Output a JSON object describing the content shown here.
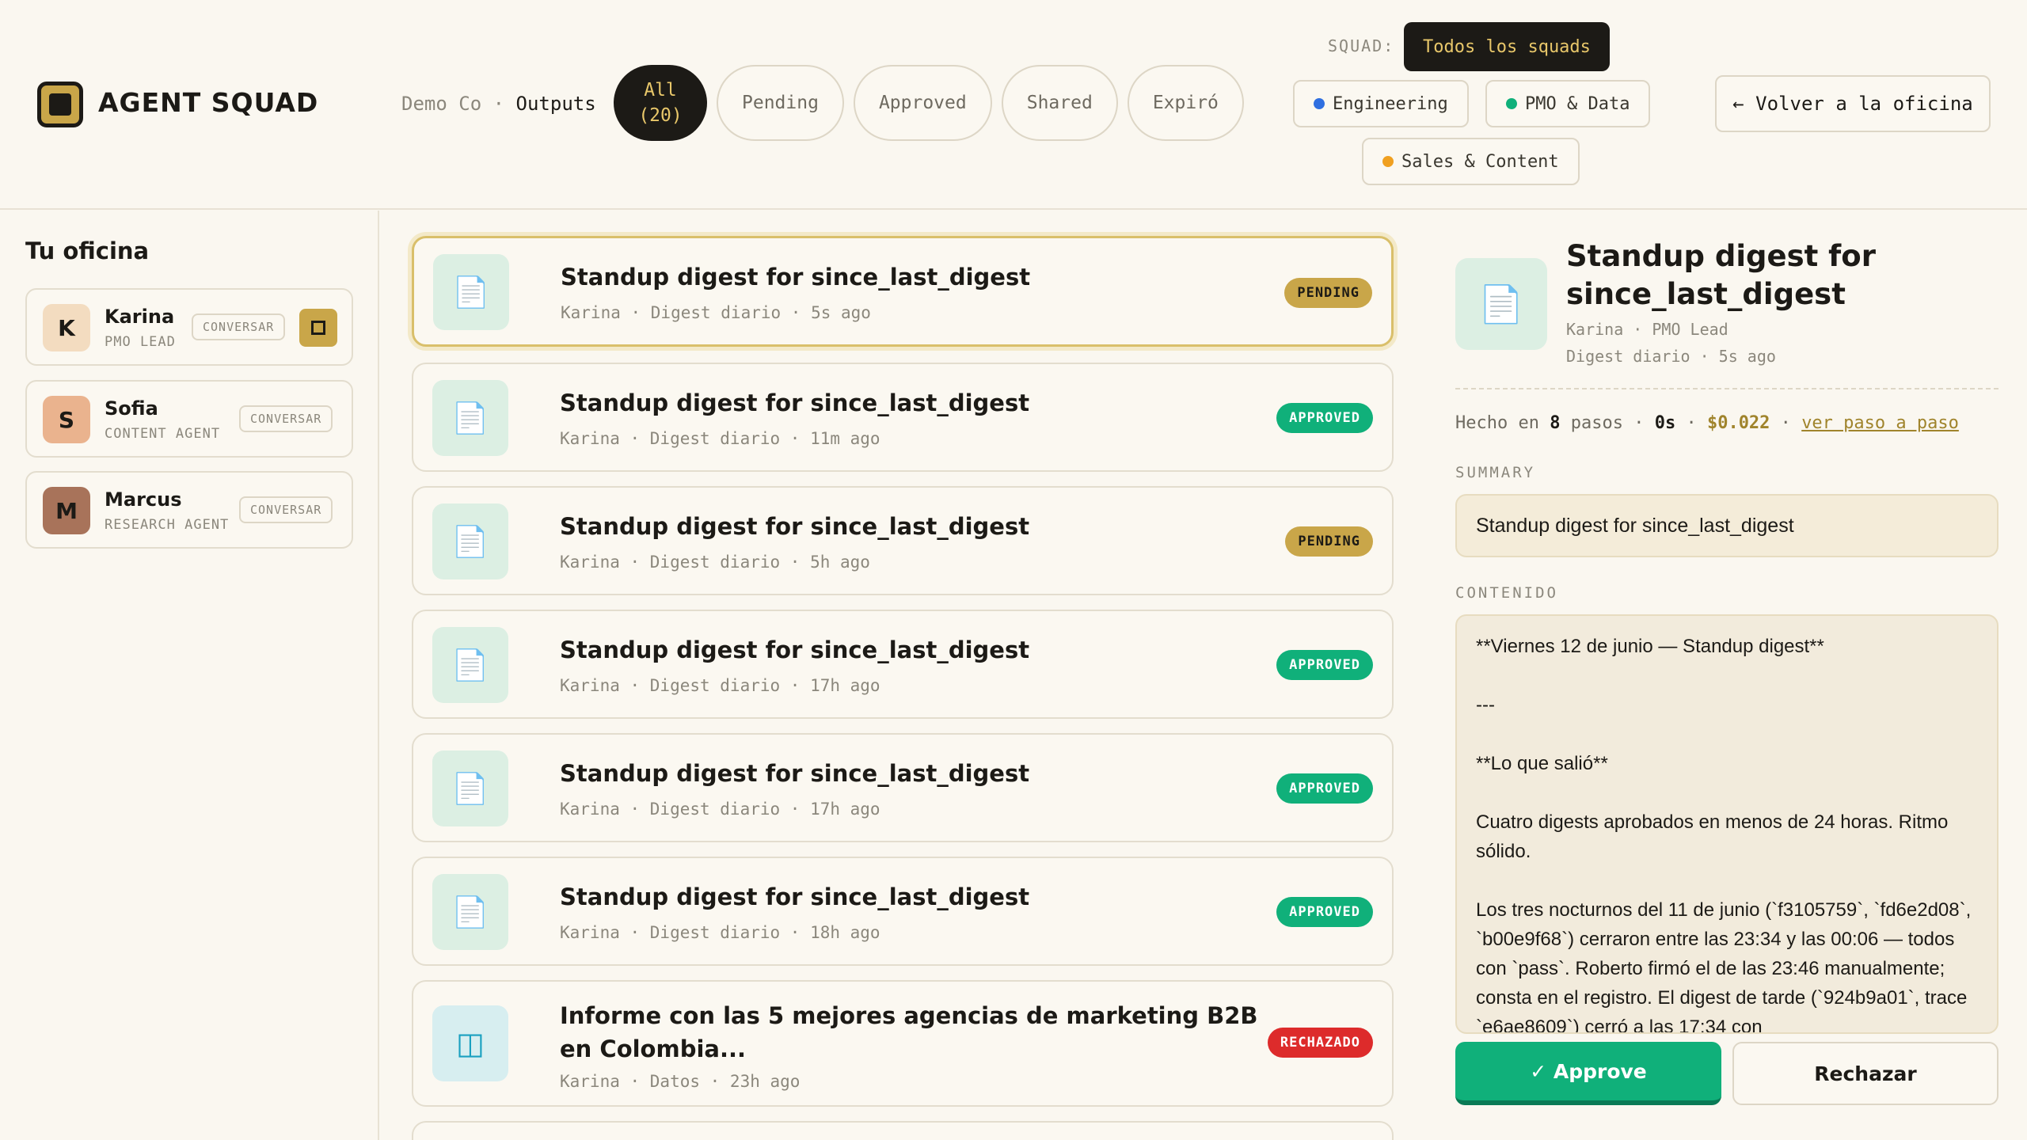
{
  "header": {
    "brand": "AGENT SQUAD",
    "company": "Demo Co",
    "sep": "·",
    "section": "Outputs",
    "tabs": [
      {
        "label": "All\n(20)"
      },
      {
        "label": "Pending"
      },
      {
        "label": "Approved"
      },
      {
        "label": "Shared"
      },
      {
        "label": "Expiró"
      }
    ],
    "squad_label": "SQUAD:",
    "squad_all": "Todos los squads",
    "squads": [
      {
        "label": "Engineering",
        "color": "#2f6fe0"
      },
      {
        "label": "PMO & Data",
        "color": "#10b07a"
      },
      {
        "label": "Sales & Content",
        "color": "#f0a020"
      }
    ],
    "back_label": "← Volver a la oficina"
  },
  "sidebar": {
    "title": "Tu oficina",
    "agents": [
      {
        "initial": "K",
        "name": "Karina",
        "role": "PMO LEAD",
        "action": "CONVERSAR"
      },
      {
        "initial": "S",
        "name": "Sofia",
        "role": "CONTENT AGENT",
        "action": "CONVERSAR"
      },
      {
        "initial": "M",
        "name": "Marcus",
        "role": "RESEARCH AGENT",
        "action": "CONVERSAR"
      }
    ]
  },
  "outputs": [
    {
      "title": "Standup digest for since_last_digest",
      "meta": "Karina · Digest diario · 5s ago",
      "status": "PENDING"
    },
    {
      "title": "Standup digest for since_last_digest",
      "meta": "Karina · Digest diario · 11m ago",
      "status": "APPROVED"
    },
    {
      "title": "Standup digest for since_last_digest",
      "meta": "Karina · Digest diario · 5h ago",
      "status": "PENDING"
    },
    {
      "title": "Standup digest for since_last_digest",
      "meta": "Karina · Digest diario · 17h ago",
      "status": "APPROVED"
    },
    {
      "title": "Standup digest for since_last_digest",
      "meta": "Karina · Digest diario · 17h ago",
      "status": "APPROVED"
    },
    {
      "title": "Standup digest for since_last_digest",
      "meta": "Karina · Digest diario · 18h ago",
      "status": "APPROVED"
    },
    {
      "title": "Informe con las 5 mejores agencias de marketing B2B en Colombia...",
      "meta": "Karina · Datos · 23h ago",
      "status": "RECHAZADO"
    }
  ],
  "detail": {
    "title": "Standup digest for since_last_digest",
    "meta1": "Karina · PMO Lead",
    "meta2": "Digest diario · 5s ago",
    "steps_prefix": "Hecho en",
    "steps_count": "8",
    "steps_word": "pasos",
    "duration": "0s",
    "cost": "$0.022",
    "steps_link": "ver paso a paso",
    "summary_label": "SUMMARY",
    "summary": "Standup digest for since_last_digest",
    "content_label": "CONTENIDO",
    "content": "**Viernes 12 de junio — Standup digest**\n\n---\n\n**Lo que salió**\n\nCuatro digests aprobados en menos de 24 horas. Ritmo sólido.\n\nLos tres nocturnos del 11 de junio (`f3105759`, `fd6e2d08`, `b00e9f68`) cerraron entre las 23:34 y las 00:06 — todos con `pass`. Roberto firmó el de las 23:46 manualmente; consta en el registro. El digest de tarde (`924b9a01`, trace `e6ae8609`) cerró a las 17:34 con",
    "approve_label": "✓ Approve",
    "reject_label": "Rechazar"
  }
}
